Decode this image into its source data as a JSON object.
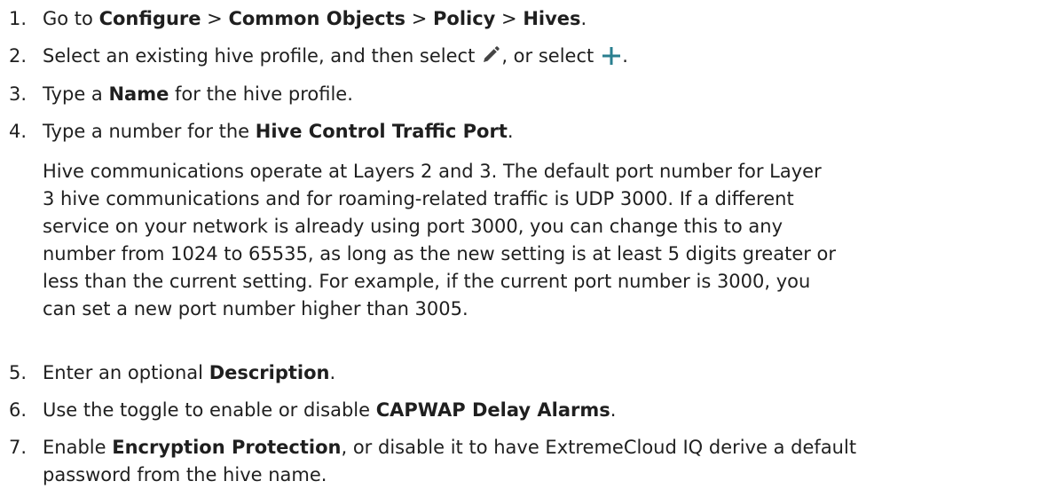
{
  "steps": [
    {
      "number": "1.",
      "t1": "Go to ",
      "b1": "Configure",
      "t2": " > ",
      "b2": "Common Objects",
      "t3": " > ",
      "b3": "Policy",
      "t4": " > ",
      "b4": "Hives",
      "t5": "."
    },
    {
      "number": "2.",
      "t1": "Select an existing hive profile, and then select",
      "t2": ", or select",
      "t3": "."
    },
    {
      "number": "3.",
      "t1": "Type a ",
      "b1": "Name",
      "t2": " for the hive profile."
    },
    {
      "number": "4.",
      "t1": "Type a number for the ",
      "b1": "Hive Control Traffic Port",
      "t2": ".",
      "paragraph_lines": [
        "Hive communications operate at Layers 2 and 3. The default port number for Layer",
        "3 hive communications and for roaming-related traffic is UDP 3000. If a different",
        "service on your network is already using port 3000, you can change this to any",
        "number from 1024 to 65535, as long as the new setting is at least 5 digits greater or",
        "less than the current setting. For example, if the current port number is 3000, you",
        "can set a new port number higher than 3005."
      ]
    },
    {
      "number": "5.",
      "t1": "Enter an optional ",
      "b1": "Description",
      "t2": "."
    },
    {
      "number": "6.",
      "t1": "Use the toggle to enable or disable ",
      "b1": "CAPWAP Delay Alarms",
      "t2": "."
    },
    {
      "number": "7.",
      "t1": "Enable ",
      "b1": "Encryption Protection",
      "t2": ", or disable it to have ExtremeCloud IQ derive a default",
      "line2": "password from the hive name."
    }
  ],
  "icons": {
    "edit": "pencil-icon",
    "add": "plus-icon"
  },
  "colors": {
    "text": "#1f1f1f",
    "pencil": "#444444",
    "plus": "#2a7f8f"
  }
}
